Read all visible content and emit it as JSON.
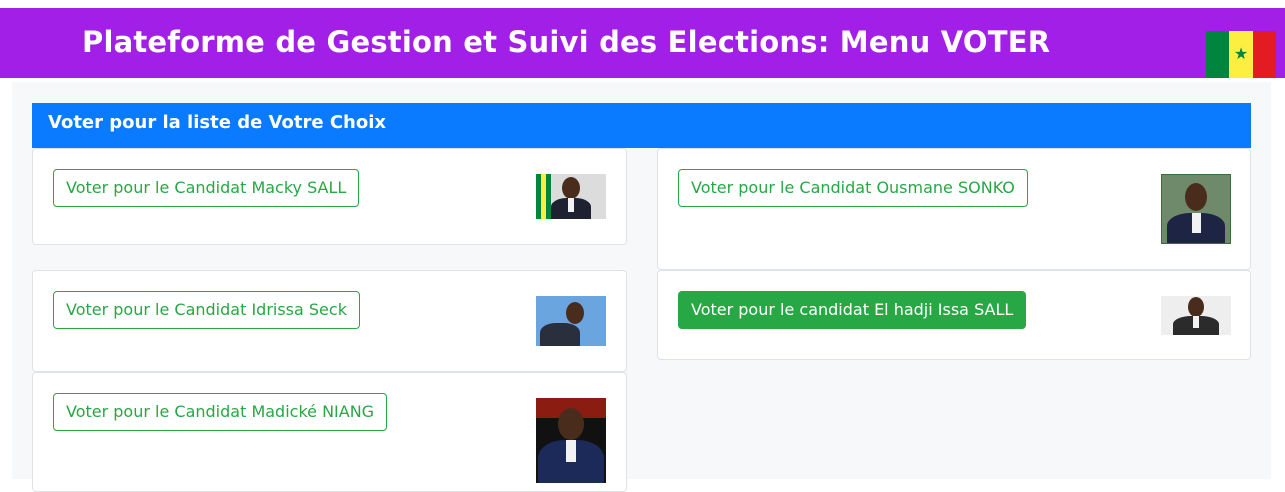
{
  "header": {
    "title": "Plateforme de Gestion et Suivi des Elections: Menu VOTER",
    "flag_icon": "senegal-flag-icon",
    "flag_colors": [
      "#00853f",
      "#fdef42",
      "#e31b23"
    ]
  },
  "panel": {
    "title": "Voter pour la liste de Votre Choix"
  },
  "candidates": [
    {
      "button_label": "Voter pour le Candidat Macky SALL",
      "style": "outline"
    },
    {
      "button_label": "Voter pour le Candidat Ousmane SONKO",
      "style": "outline"
    },
    {
      "button_label": "Voter pour le Candidat Idrissa Seck",
      "style": "outline"
    },
    {
      "button_label": "Voter pour le candidat El hadji Issa SALL",
      "style": "solid"
    },
    {
      "button_label": "Voter pour le Candidat Madické NIANG",
      "style": "outline"
    }
  ],
  "colors": {
    "header_bg": "#a21fe8",
    "panel_header_bg": "#0a7bff",
    "button_green": "#28a745"
  }
}
